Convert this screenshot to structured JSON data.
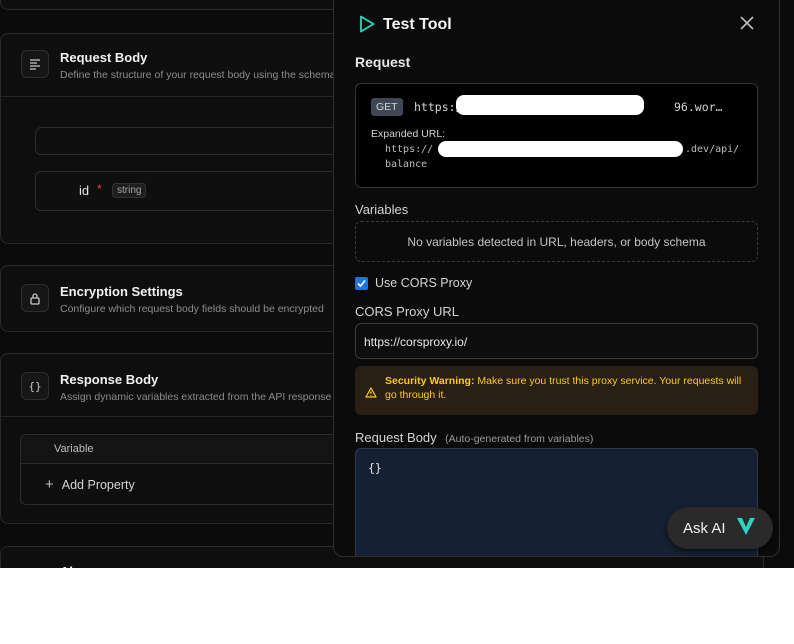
{
  "background": {
    "request_body": {
      "title": "Request Body",
      "subtitle": "Define the structure of your request body using the schema"
    },
    "field": {
      "name": "id",
      "required_mark": "*",
      "type": "string"
    },
    "encryption": {
      "title": "Encryption Settings",
      "subtitle": "Configure which request body fields should be encrypted"
    },
    "response_body": {
      "title": "Response Body",
      "subtitle": "Assign dynamic variables extracted from the API response"
    },
    "table_header": "Variable",
    "add_property": "Add Property",
    "bottom_partial": "Al"
  },
  "panel": {
    "title": "Test Tool",
    "request_label": "Request",
    "method": "GET",
    "url_visible_start": "https:/",
    "url_visible_end": "96.wor…",
    "expanded_label": "Expanded URL:",
    "expanded_start": "https://",
    "expanded_end": ".dev/api/",
    "expanded_line2": "balance",
    "variables_label": "Variables",
    "variables_empty": "No variables detected in URL, headers, or body schema",
    "cors_checkbox_label": "Use CORS Proxy",
    "cors_checked": true,
    "cors_url_label": "CORS Proxy URL",
    "cors_url_value": "https://corsproxy.io/",
    "warning_title": "Security Warning:",
    "warning_text": "Make sure you trust this proxy service. Your requests will go through it.",
    "request_body_label": "Request Body",
    "request_body_hint": "(Auto-generated from variables)",
    "request_body_value": "{}"
  },
  "ask_ai": {
    "label": "Ask AI"
  },
  "colors": {
    "accent": "#2dd4bf",
    "warning_text": "#facc15",
    "warning_bg": "#2a1f14",
    "body_editor_bg": "#152033"
  }
}
